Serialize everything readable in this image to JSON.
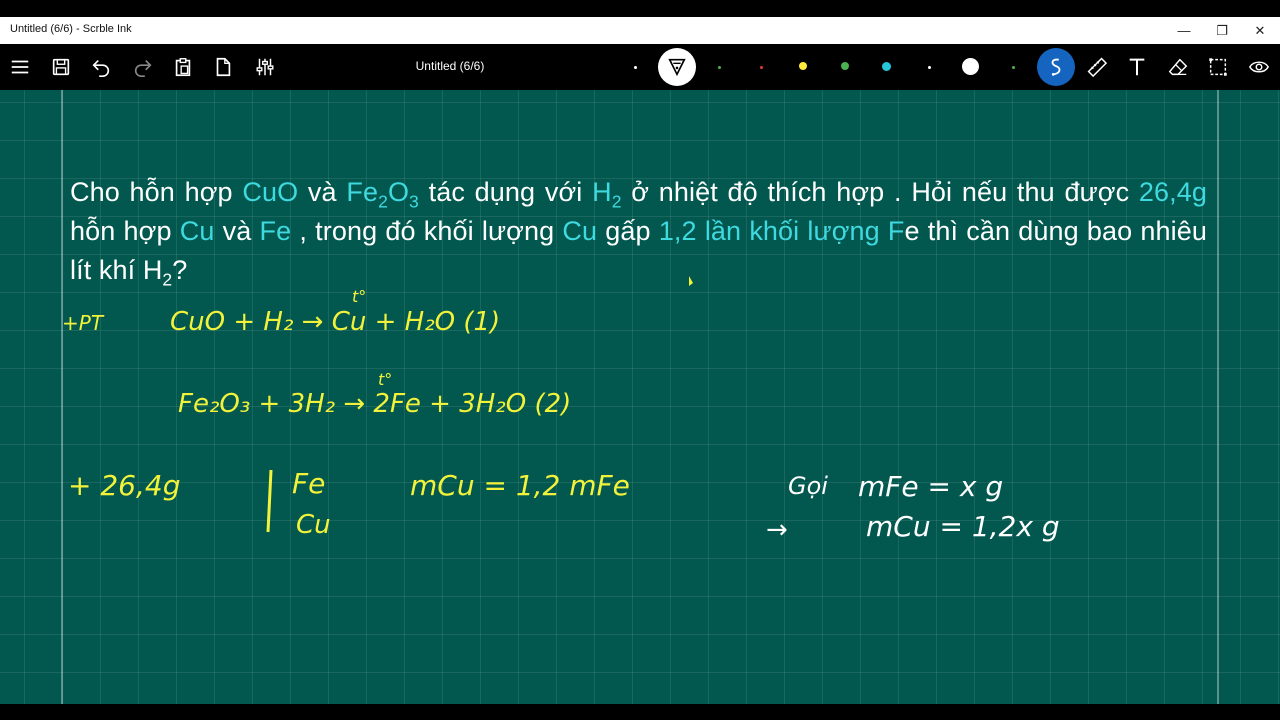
{
  "window": {
    "title": "Untitled (6/6) - Scrble Ink",
    "minimize": "—",
    "restore": "❐",
    "close": "✕"
  },
  "toolbar": {
    "doc_title": "Untitled (6/6)",
    "tools_left": [
      "menu-icon",
      "save-icon",
      "undo-icon",
      "redo-icon",
      "paste-icon",
      "new-page-icon",
      "settings-sliders-icon"
    ],
    "tools_right": [
      "lasso-icon",
      "ruler-icon",
      "text-icon",
      "eraser-icon",
      "select-icon",
      "view-icon"
    ],
    "pen_colors": [
      "#ffffff",
      "#4caf50",
      "#e53935",
      "#ffeb3b",
      "#4caf50",
      "#26c6da",
      "#ffffff",
      "#ffffff"
    ],
    "active_pen_color": "#ffffff",
    "accent": "#1565c0"
  },
  "problem": {
    "t1": "Cho hỗn hợp ",
    "cuo": "CuO",
    "t2": " và ",
    "fe2o3_a": "Fe",
    "fe2o3_b": "2",
    "fe2o3_c": "O",
    "fe2o3_d": "3",
    "t3": " tác dụng với ",
    "h2_a": "H",
    "h2_b": "2",
    "t4": " ở nhiệt độ thích hợp . Hỏi nếu thu được ",
    "mass": "26,4g",
    "t5": " hỗn hợp ",
    "cu": "Cu",
    "t6": " và ",
    "fe": "Fe",
    "t7": " , trong đó khối lượng ",
    "cu2": "Cu",
    "t8": " gấp ",
    "ratio": "1,2 lần khối lượng F",
    "t9": "e thì cần dùng bao nhiêu lít khí H",
    "t10": "2",
    "t11": "?"
  },
  "handwriting": {
    "pt_label": "+PT",
    "eq1": "CuO + H₂ → Cu + H₂O (1)",
    "eq1_cond": "t°",
    "eq2": "Fe₂O₃ + 3H₂ → 2Fe + 3H₂O (2)",
    "eq2_cond": "t°",
    "mix_mass": "+ 26,4g",
    "mix_fe": "Fe",
    "mix_cu": "Cu",
    "relation": "mCu = 1,2 mFe",
    "goi": "Gọi",
    "mfe_def": "mFe = x g",
    "mcu_def": "mCu = 1,2x g",
    "arrow": "→"
  },
  "colors": {
    "canvas": "#02584f",
    "ink_yellow": "#f2f23a",
    "ink_white": "#ffffff",
    "highlight": "#3fd9e0"
  }
}
